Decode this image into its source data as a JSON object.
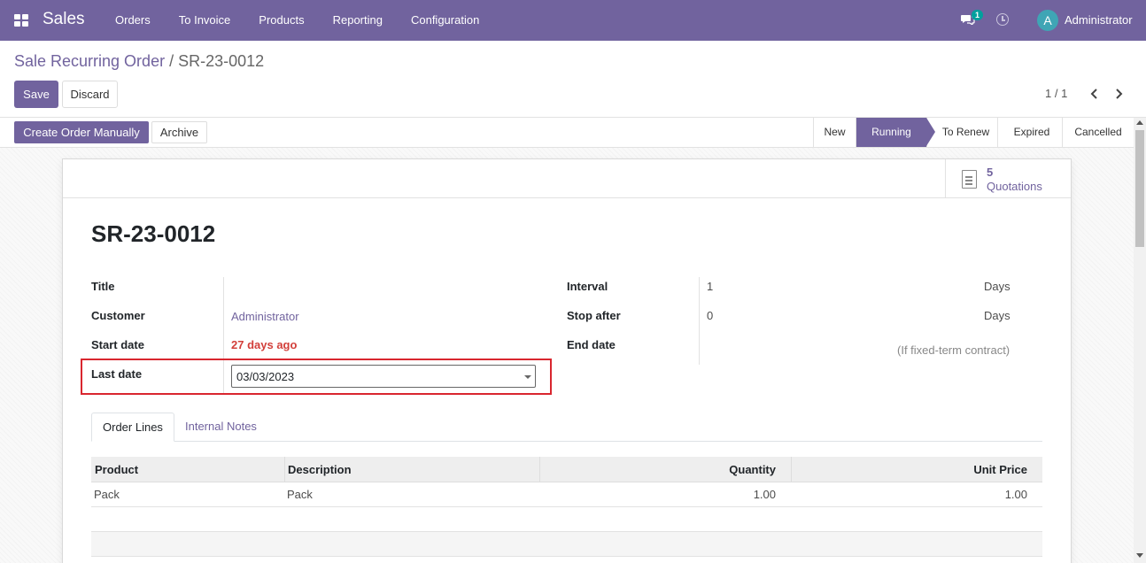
{
  "navbar": {
    "brand": "Sales",
    "menu": [
      "Orders",
      "To Invoice",
      "Products",
      "Reporting",
      "Configuration"
    ],
    "chat_badge": "1",
    "avatar_letter": "A",
    "user": "Administrator"
  },
  "breadcrumb": {
    "parent": "Sale Recurring Order",
    "separator": "/",
    "current": "SR-23-0012"
  },
  "actions": {
    "save": "Save",
    "discard": "Discard",
    "create_manual": "Create Order Manually",
    "archive": "Archive"
  },
  "pager": "1 / 1",
  "stages": {
    "items": [
      "New",
      "Running",
      "To Renew",
      "Expired",
      "Cancelled"
    ],
    "active": "Running"
  },
  "smart_button": {
    "count": "5",
    "label": "Quotations",
    "icon": "document-icon"
  },
  "record": {
    "name": "SR-23-0012",
    "left_fields": {
      "title_label": "Title",
      "title_value": "",
      "customer_label": "Customer",
      "customer_value": "Administrator",
      "start_label": "Start date",
      "start_value": "27 days ago",
      "last_label": "Last date",
      "last_value": "03/03/2023"
    },
    "right_fields": {
      "interval_label": "Interval",
      "interval_value": "1",
      "interval_unit": "Days",
      "stop_label": "Stop after",
      "stop_value": "0",
      "stop_unit": "Days",
      "end_label": "End date",
      "end_hint": "(If fixed-term contract)"
    }
  },
  "tabs": [
    "Order Lines",
    "Internal Notes"
  ],
  "order_lines": {
    "columns": [
      "Product",
      "Description",
      "Quantity",
      "Unit Price"
    ],
    "rows": [
      {
        "product": "Pack",
        "description": "Pack",
        "quantity": "1.00",
        "unit_price": "1.00"
      }
    ]
  },
  "colors": {
    "brand": "#71639e",
    "danger": "#d23f3a",
    "highlight": "#d9262f"
  }
}
